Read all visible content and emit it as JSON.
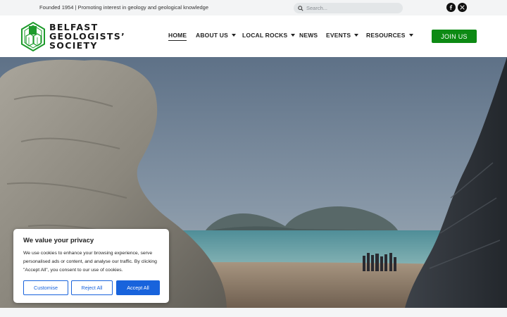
{
  "topbar": {
    "tagline": "Founded 1954 | Promoting interest in geology and geological knowledge",
    "search_placeholder": "Search...",
    "social": [
      "facebook-icon",
      "x-twitter-icon"
    ]
  },
  "logo": {
    "line1": "BELFAST",
    "line2": "GEOLOGISTS’",
    "line3": "SOCIETY"
  },
  "nav": {
    "items": [
      {
        "label": "HOME",
        "active": true,
        "dropdown": false
      },
      {
        "label": "ABOUT US",
        "active": false,
        "dropdown": true
      },
      {
        "label": "LOCAL ROCKS",
        "active": false,
        "dropdown": true
      },
      {
        "label": "NEWS",
        "active": false,
        "dropdown": false
      },
      {
        "label": "EVENTS",
        "active": false,
        "dropdown": true
      },
      {
        "label": "RESOURCES",
        "active": false,
        "dropdown": true
      }
    ],
    "join_label": "JOIN US"
  },
  "cookie": {
    "title": "We value your privacy",
    "body": "We use cookies to enhance your browsing experience, serve personalised ads or content, and analyse our traffic. By clicking \"Accept All\", you consent to our use of cookies.",
    "customise": "Customise",
    "reject": "Reject All",
    "accept": "Accept All"
  },
  "colors": {
    "brand_green": "#0d8a14",
    "cookie_blue": "#1863dc",
    "topbar_bg": "#f3f4f5"
  }
}
